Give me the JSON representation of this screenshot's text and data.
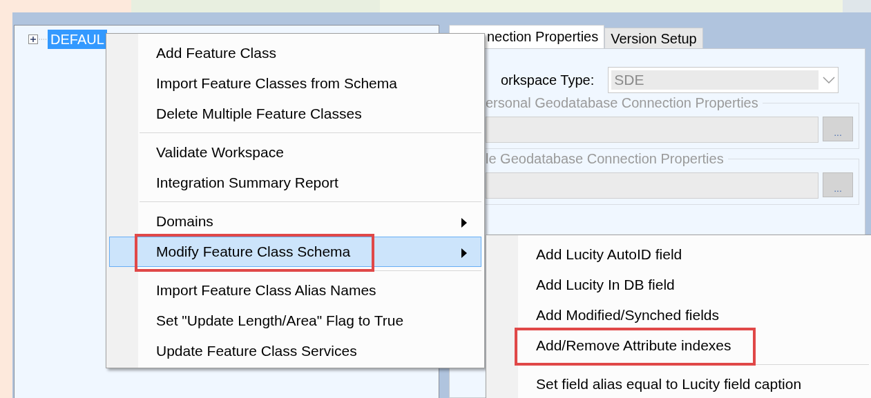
{
  "tree": {
    "items": [
      {
        "label": "DEFAUL",
        "selected": true,
        "expanded": false
      }
    ]
  },
  "tabs": [
    {
      "label": "nection Properties",
      "selected": true
    },
    {
      "label": "Version Setup",
      "selected": false
    }
  ],
  "workspace_type": {
    "label": "orkspace Type:",
    "value": "SDE",
    "disabled": true
  },
  "groups": [
    {
      "title": "ersonal Geodatabase Connection Properties",
      "button": "...",
      "disabled": true
    },
    {
      "title": "le Geodatabase Connection Properties",
      "button": "...",
      "disabled": true
    }
  ],
  "context_menu": {
    "sections": [
      {
        "items": [
          {
            "label": "Add Feature Class",
            "selected": false,
            "submenu": false,
            "highlight": false
          },
          {
            "label": "Import Feature Classes from Schema",
            "selected": false,
            "submenu": false,
            "highlight": false
          },
          {
            "label": "Delete Multiple Feature Classes",
            "selected": false,
            "submenu": false,
            "highlight": false
          }
        ]
      },
      {
        "items": [
          {
            "label": "Validate Workspace",
            "selected": false,
            "submenu": false,
            "highlight": false
          },
          {
            "label": "Integration Summary Report",
            "selected": false,
            "submenu": false,
            "highlight": false
          }
        ]
      },
      {
        "items": [
          {
            "label": "Domains",
            "selected": false,
            "submenu": true,
            "highlight": false
          },
          {
            "label": "Modify Feature Class Schema",
            "selected": true,
            "submenu": true,
            "highlight": true
          }
        ]
      },
      {
        "items": [
          {
            "label": "Import Feature Class Alias Names",
            "selected": false,
            "submenu": false,
            "highlight": false
          },
          {
            "label": "Set \"Update Length/Area\" Flag to True",
            "selected": false,
            "submenu": false,
            "highlight": false
          },
          {
            "label": "Update Feature Class Services",
            "selected": false,
            "submenu": false,
            "highlight": false
          }
        ]
      }
    ]
  },
  "submenu": {
    "sections": [
      {
        "items": [
          {
            "label": "Add Lucity AutoID field",
            "selected": false,
            "submenu": false,
            "highlight": false
          },
          {
            "label": "Add Lucity In DB field",
            "selected": false,
            "submenu": false,
            "highlight": false
          },
          {
            "label": "Add Modified/Synched fields",
            "selected": false,
            "submenu": false,
            "highlight": false
          },
          {
            "label": "Add/Remove Attribute indexes",
            "selected": false,
            "submenu": false,
            "highlight": true
          }
        ]
      },
      {
        "items": [
          {
            "label": "Set field alias equal to Lucity field caption",
            "selected": false,
            "submenu": false,
            "highlight": false
          }
        ]
      }
    ]
  }
}
